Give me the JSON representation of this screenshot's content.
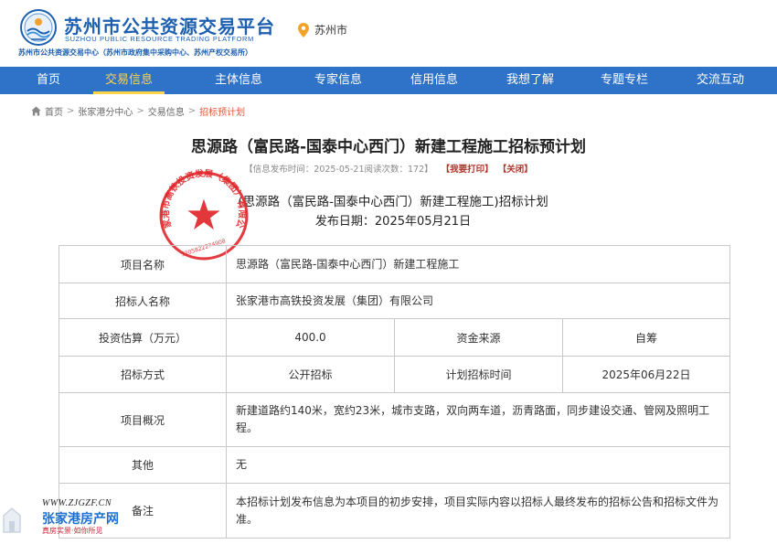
{
  "header": {
    "site_name": "苏州市公共资源交易平台",
    "site_name_en": "SUZHOU PUBLIC RESOURCE TRADING PLATFORM",
    "site_sub": "苏州市公共资源交易中心（苏州市政府集中采购中心、苏州产权交易所）",
    "location": "苏州市"
  },
  "nav": {
    "items": [
      {
        "label": "首页"
      },
      {
        "label": "交易信息"
      },
      {
        "label": "主体信息"
      },
      {
        "label": "专家信息"
      },
      {
        "label": "信用信息"
      },
      {
        "label": "我想了解"
      },
      {
        "label": "专题专栏"
      },
      {
        "label": "交流互动"
      }
    ],
    "active_index": 1
  },
  "breadcrumb": {
    "items": [
      "首页",
      "张家港分中心",
      "交易信息",
      "招标预计划"
    ],
    "separator": ">"
  },
  "article": {
    "title": "思源路（富民路-国泰中心西门）新建工程施工招标预计划",
    "meta_text": "【信息发布时间：2025-05-21阅读次数：172】",
    "print_label": "【我要打印】",
    "close_label": "【关闭】",
    "sub_title": "(思源路（富民路-国泰中心西门）新建工程施工)招标计划",
    "pub_date": "发布日期：2025年05月21日",
    "seal_text": "张家港市高铁投资发展（集团）有限公司",
    "seal_number": "3205822274908"
  },
  "table": {
    "project_name_label": "项目名称",
    "project_name": "思源路（富民路-国泰中心西门）新建工程施工",
    "tenderer_label": "招标人名称",
    "tenderer": "张家港市高铁投资发展（集团）有限公司",
    "investment_label": "投资估算（万元）",
    "investment": "400.0",
    "fund_source_label": "资金来源",
    "fund_source": "自筹",
    "method_label": "招标方式",
    "method": "公开招标",
    "plan_time_label": "计划招标时间",
    "plan_time": "2025年06月22日",
    "overview_label": "项目概况",
    "overview": "新建道路约140米，宽约23米，城市支路，双向两车道，沥青路面，同步建设交通、管网及照明工程。",
    "other_label": "其他",
    "other": "无",
    "remark_label": "备注",
    "remark": "本招标计划发布信息为本项目的初步安排，项目实际内容以招标人最终发布的招标公告和招标文件为准。"
  },
  "watermark": {
    "url": "WWW.ZJGZF.CN",
    "name": "张家港房产网",
    "slogan": "真房实景·如你所见"
  },
  "colors": {
    "brand_blue": "#1c5fb0",
    "nav_bg": "#2f73c9",
    "nav_active": "#ffd34d",
    "breadcrumb_current": "#e2573b",
    "seal_red": "#e0262a"
  }
}
